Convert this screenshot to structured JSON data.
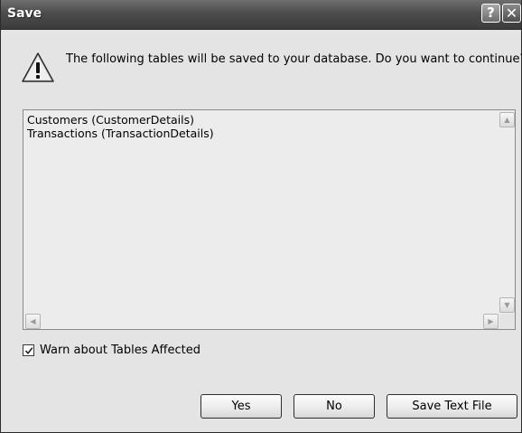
{
  "window": {
    "title": "Save",
    "help_glyph": "?",
    "close_glyph": "✕"
  },
  "message": {
    "icon": "warning-triangle-icon",
    "text": "The following tables will be saved to your database. Do you want to continue?"
  },
  "tables_list": {
    "items": [
      "Customers (CustomerDetails)",
      "Transactions (TransactionDetails)"
    ]
  },
  "options": {
    "warn_label": "Warn about Tables Affected",
    "warn_checked": true
  },
  "buttons": {
    "yes": "Yes",
    "no": "No",
    "save_text_file": "Save Text File"
  }
}
